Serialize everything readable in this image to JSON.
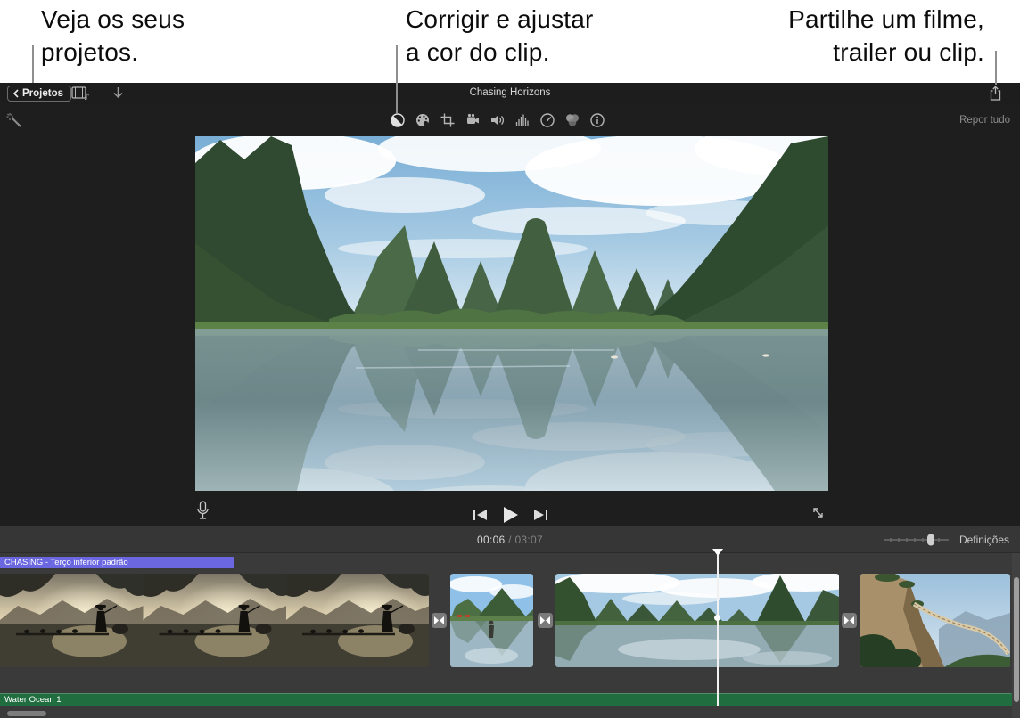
{
  "callouts": {
    "left": {
      "line1": "Veja os seus",
      "line2": "projetos."
    },
    "center": {
      "line1": "Corrigir e ajustar",
      "line2": "a cor do clip."
    },
    "right": {
      "line1": "Partilhe um filme,",
      "line2": "trailer ou clip."
    }
  },
  "topbar": {
    "back_button": "Projetos",
    "title": "Chasing Horizons",
    "icons": [
      "media-browser",
      "download",
      "share"
    ]
  },
  "adjustbar": {
    "reset_label": "Repor tudo",
    "icons": [
      "color-balance",
      "color-correction",
      "crop",
      "stabilization",
      "volume",
      "noise-reduction",
      "speed",
      "clip-filter",
      "info"
    ]
  },
  "viewer": {
    "icons": [
      "magic-wand",
      "microphone",
      "skip-back",
      "play",
      "skip-forward",
      "fullscreen"
    ]
  },
  "transport": {
    "timecode_current": "00:06",
    "timecode_separator": "/",
    "timecode_total": "03:07"
  },
  "strip": {
    "settings_label": "Definições"
  },
  "timeline": {
    "title_overlay": "CHASING - Terço inferior padrão",
    "audio_label": "Water Ocean 1",
    "colors": {
      "title_overlay_bg": "#6a67e0",
      "audio_track_bg": "#206e3f"
    }
  }
}
